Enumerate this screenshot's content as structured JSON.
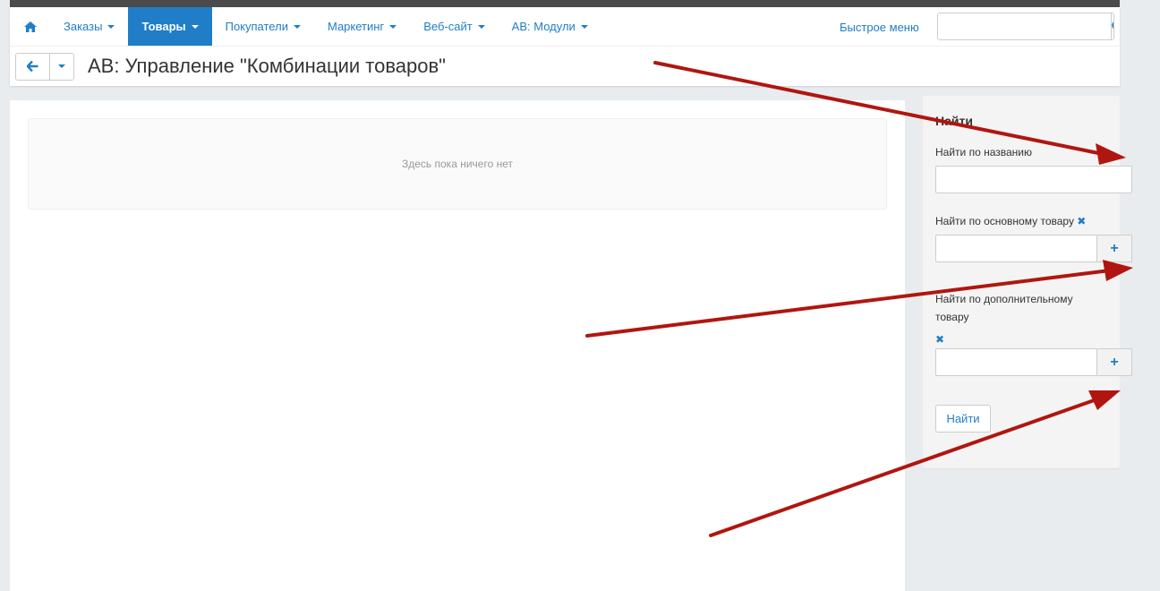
{
  "nav": {
    "home_icon": "home-icon",
    "items": [
      {
        "label": "Заказы"
      },
      {
        "label": "Товары"
      },
      {
        "label": "Покупатели"
      },
      {
        "label": "Маркетинг"
      },
      {
        "label": "Веб-сайт"
      },
      {
        "label": "AB: Модули"
      }
    ],
    "quick_menu": "Быстрое меню",
    "search": {
      "value": "",
      "placeholder": ""
    }
  },
  "page": {
    "title": "AB: Управление \"Комбинации товаров\""
  },
  "main": {
    "empty_text": "Здесь пока ничего нет"
  },
  "sidebar": {
    "title": "Найти",
    "name_label": "Найти по названию",
    "main_product_label": "Найти по основному товару",
    "additional_product_label_1": "Найти по дополнительному",
    "additional_product_label_2": "товару",
    "plus": "+",
    "clear": "✖",
    "find_button": "Найти"
  },
  "colors": {
    "accent": "#1f7ec7",
    "arrow": "#b0160f",
    "top_strip": "#4b4b4b"
  }
}
